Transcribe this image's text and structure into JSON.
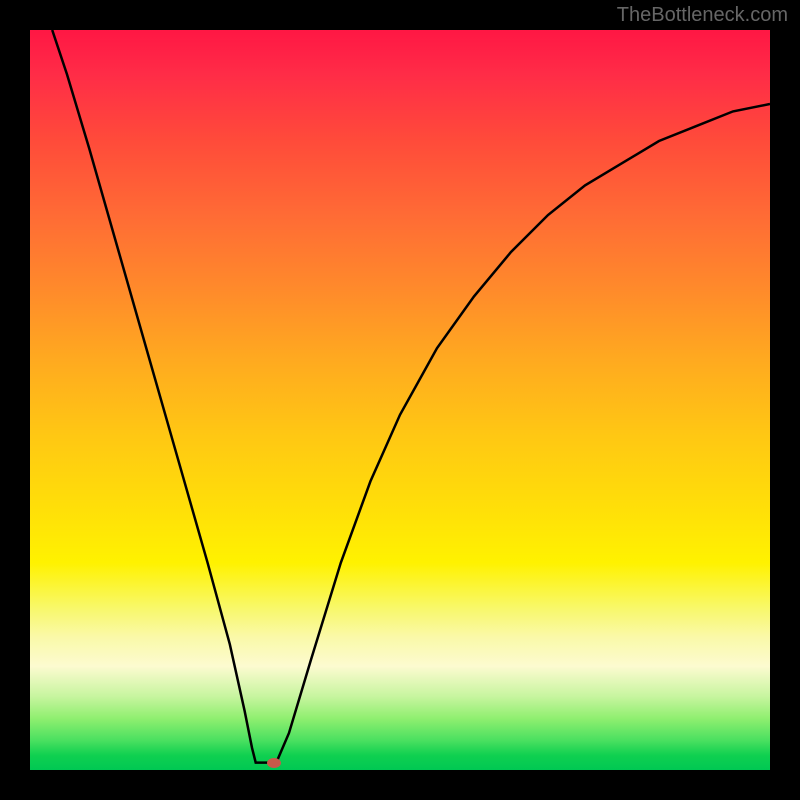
{
  "watermark": "TheBottleneck.com",
  "chart_data": {
    "type": "line",
    "title": "",
    "xlabel": "",
    "ylabel": "",
    "x_range": [
      0,
      100
    ],
    "y_range": [
      0,
      100
    ],
    "curve_points": [
      {
        "x": 3,
        "y": 100
      },
      {
        "x": 5,
        "y": 94
      },
      {
        "x": 8,
        "y": 84
      },
      {
        "x": 12,
        "y": 70
      },
      {
        "x": 16,
        "y": 56
      },
      {
        "x": 20,
        "y": 42
      },
      {
        "x": 24,
        "y": 28
      },
      {
        "x": 27,
        "y": 17
      },
      {
        "x": 29,
        "y": 8
      },
      {
        "x": 30,
        "y": 3
      },
      {
        "x": 30.5,
        "y": 1
      },
      {
        "x": 33,
        "y": 1
      },
      {
        "x": 33.5,
        "y": 1.5
      },
      {
        "x": 35,
        "y": 5
      },
      {
        "x": 38,
        "y": 15
      },
      {
        "x": 42,
        "y": 28
      },
      {
        "x": 46,
        "y": 39
      },
      {
        "x": 50,
        "y": 48
      },
      {
        "x": 55,
        "y": 57
      },
      {
        "x": 60,
        "y": 64
      },
      {
        "x": 65,
        "y": 70
      },
      {
        "x": 70,
        "y": 75
      },
      {
        "x": 75,
        "y": 79
      },
      {
        "x": 80,
        "y": 82
      },
      {
        "x": 85,
        "y": 85
      },
      {
        "x": 90,
        "y": 87
      },
      {
        "x": 95,
        "y": 89
      },
      {
        "x": 100,
        "y": 90
      }
    ],
    "marker": {
      "x": 33,
      "y": 1
    },
    "gradient_colors": {
      "top": "#ff1744",
      "middle": "#ffe008",
      "bottom": "#00c853"
    }
  }
}
